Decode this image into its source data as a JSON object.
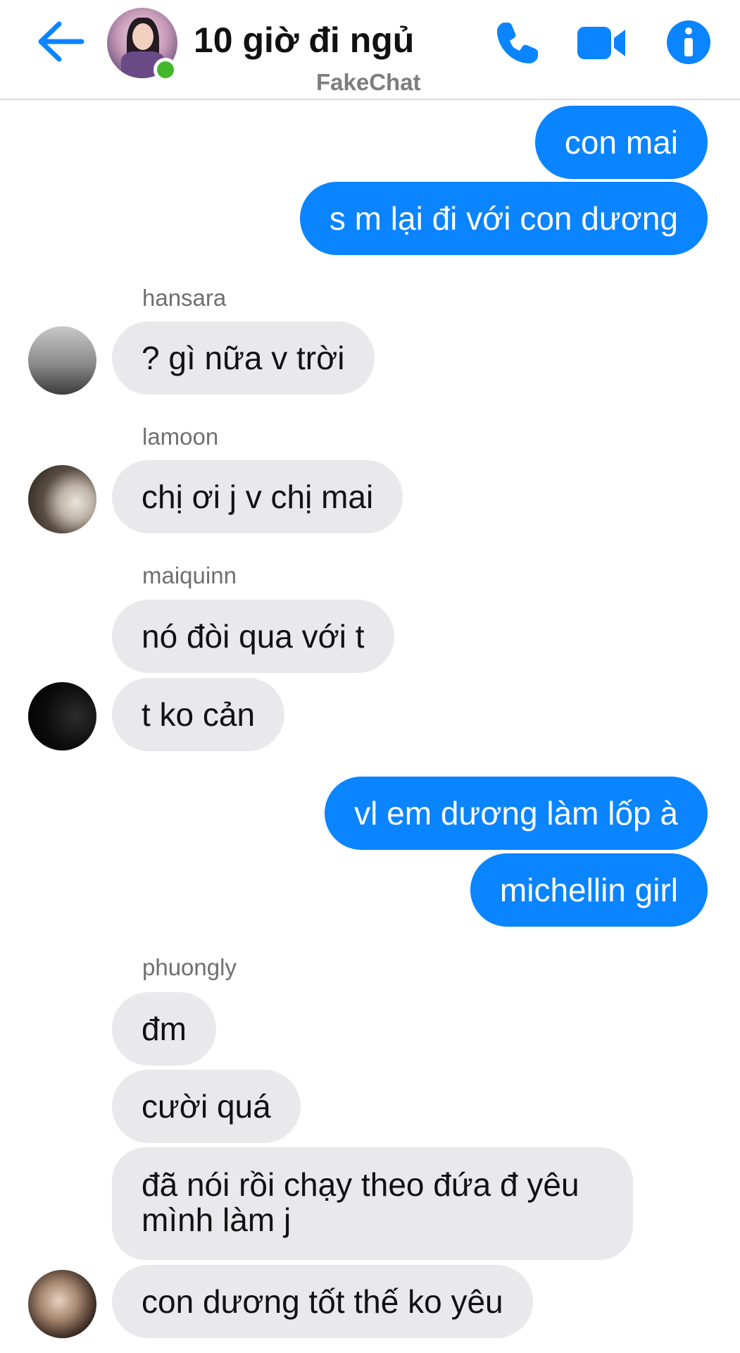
{
  "header": {
    "title": "10 giờ đi ngủ",
    "subtitle": "FakeChat",
    "accent_color": "#0a84ff",
    "online_color": "#42b72a",
    "icons": [
      "back-arrow-icon",
      "phone-icon",
      "video-camera-icon",
      "info-icon"
    ]
  },
  "messages": [
    {
      "text": "con mai",
      "direction": "outgoing"
    },
    {
      "text": "s m lại đi với con dương",
      "direction": "outgoing"
    },
    {
      "sender": "hansara",
      "text": "? gì nữa v trời",
      "direction": "incoming"
    },
    {
      "sender": "lamoon",
      "text": "chị ơi j v chị mai",
      "direction": "incoming"
    },
    {
      "sender": "maiquinn",
      "text": "nó đòi qua với t",
      "direction": "incoming"
    },
    {
      "text": "t ko cản",
      "direction": "incoming"
    },
    {
      "text": "vl em dương làm lốp à",
      "direction": "outgoing"
    },
    {
      "text": "michellin girl",
      "direction": "outgoing"
    },
    {
      "sender": "phuongly",
      "text": "đm",
      "direction": "incoming"
    },
    {
      "text": "cười quá",
      "direction": "incoming"
    },
    {
      "text": "đã nói rồi chạy theo đứa đ yêu mình làm j",
      "direction": "incoming"
    },
    {
      "text": "con dương tốt thế ko yêu",
      "direction": "incoming"
    }
  ]
}
